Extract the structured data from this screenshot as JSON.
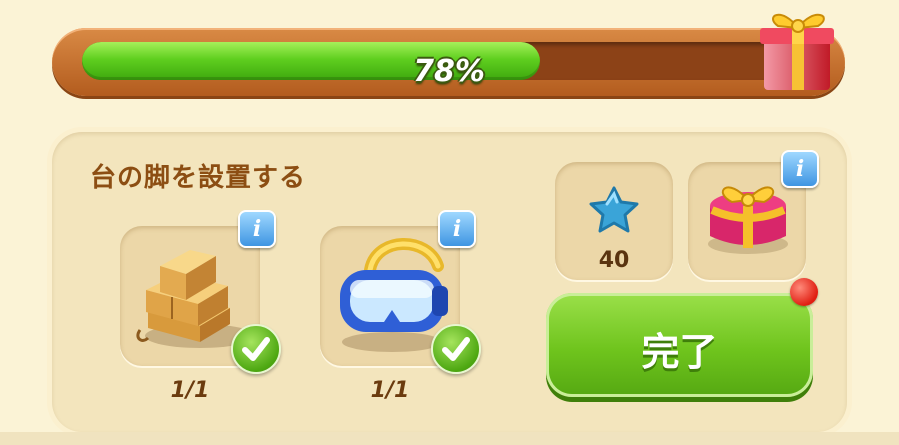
{
  "progress": {
    "percent_label": "78%",
    "percent_value": 78
  },
  "task": {
    "title": "台の脚を設置する",
    "requirements": [
      {
        "icon": "wood-planks-icon",
        "count": "1/1",
        "info_label": "i",
        "completed": true
      },
      {
        "icon": "diving-goggles-icon",
        "count": "1/1",
        "info_label": "i",
        "completed": true
      }
    ]
  },
  "rewards": [
    {
      "icon": "blue-star-icon",
      "value": "40"
    },
    {
      "icon": "gift-box-icon",
      "info_label": "i"
    }
  ],
  "done_button": {
    "label": "完了"
  },
  "colors": {
    "accent_green": "#6fc41d",
    "bar_orange": "#c86e2b",
    "title_brown": "#8c4e13"
  }
}
